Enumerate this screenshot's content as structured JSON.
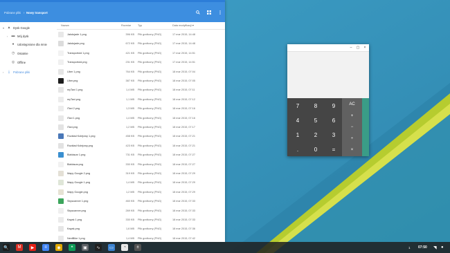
{
  "files": {
    "breadcrumb": {
      "root": "Pobrane pliki",
      "separator": "›",
      "current": "Nowy transport"
    },
    "header_icons": [
      "search-icon",
      "grid-view-icon",
      "more-vert-icon"
    ],
    "sidebar": {
      "items": [
        {
          "label": "Dysk Google",
          "icon": "drive-icon",
          "chevron": "▾"
        },
        {
          "label": "Mój dysk",
          "icon": "folder-icon",
          "chevron": "›"
        },
        {
          "label": "Udostępnione dla mnie",
          "icon": "people-icon",
          "chevron": ""
        },
        {
          "label": "Ostatnie",
          "icon": "clock-icon",
          "chevron": ""
        },
        {
          "label": "Offline",
          "icon": "offline-icon",
          "chevron": ""
        },
        {
          "label": "Pobrane pliki",
          "icon": "download-icon",
          "chevron": "›"
        }
      ]
    },
    "columns": {
      "name": "Nazwa",
      "size": "Rozmiar",
      "type": "Typ",
      "date": "Data modyfikacji ▾"
    },
    "rows": [
      {
        "name": "Jakdojade 1.png",
        "size": "396 KB",
        "type": "Plik graficzny (PNG)",
        "date": "17 mar 2015, 14:48",
        "thumb": "#e8e8e8"
      },
      {
        "name": "Jakdojade.png",
        "size": "672 KB",
        "type": "Plik graficzny (PNG)",
        "date": "17 mar 2015, 14:48",
        "thumb": "#dcdcdc"
      },
      {
        "name": "Transportoid 1.png",
        "size": "421 KB",
        "type": "Plik graficzny (PNG)",
        "date": "17 mar 2015, 14:51",
        "thumb": "#f2f2f2"
      },
      {
        "name": "Transportoid.png",
        "size": "231 KB",
        "type": "Plik graficzny (PNG)",
        "date": "17 mar 2015, 14:51",
        "thumb": "#f0f0f0"
      },
      {
        "name": "Uber 1.png",
        "size": "764 KB",
        "type": "Plik graficzny (PNG)",
        "date": "18 mar 2015, 07:04",
        "thumb": "#e5e5e5"
      },
      {
        "name": "Uber.png",
        "size": "387 KB",
        "type": "Plik graficzny (PNG)",
        "date": "18 mar 2015, 07:05",
        "thumb": "#1d1d1d"
      },
      {
        "name": "myTaxi 1.png",
        "size": "1,4 MB",
        "type": "Plik graficzny (PNG)",
        "date": "18 mar 2015, 07:11",
        "thumb": "#e6e6e6"
      },
      {
        "name": "myTaxi.png",
        "size": "1,1 MB",
        "type": "Plik graficzny (PNG)",
        "date": "18 mar 2015, 07:12",
        "thumb": "#ececec"
      },
      {
        "name": "iTaxi 2.png",
        "size": "1,3 MB",
        "type": "Plik graficzny (PNG)",
        "date": "18 mar 2015, 07:16",
        "thumb": "#ededed"
      },
      {
        "name": "iTaxi 1.png",
        "size": "1,4 MB",
        "type": "Plik graficzny (PNG)",
        "date": "18 mar 2015, 07:16",
        "thumb": "#e8e8e8"
      },
      {
        "name": "iTaxi.png",
        "size": "1,2 MB",
        "type": "Plik graficzny (PNG)",
        "date": "18 mar 2015, 07:17",
        "thumb": "#e3e3e3"
      },
      {
        "name": "Rozkład Kolejowy 1.png",
        "size": "458 KB",
        "type": "Plik graficzny (PNG)",
        "date": "18 mar 2015, 07:21",
        "thumb": "#4a78b8"
      },
      {
        "name": "Rozkład Kolejowy.png",
        "size": "423 KB",
        "type": "Plik graficzny (PNG)",
        "date": "18 mar 2015, 07:21",
        "thumb": "#e2e2e2"
      },
      {
        "name": "Blablacar 1.png",
        "size": "731 KB",
        "type": "Plik graficzny (PNG)",
        "date": "18 mar 2015, 07:27",
        "thumb": "#3a8fd0"
      },
      {
        "name": "Blablacar.png",
        "size": "330 KB",
        "type": "Plik graficzny (PNG)",
        "date": "18 mar 2015, 07:27",
        "thumb": "#f1f1f1"
      },
      {
        "name": "Mapy Google 2.png",
        "size": "319 KB",
        "type": "Plik graficzny (PNG)",
        "date": "18 mar 2015, 07:29",
        "thumb": "#e4e0d6"
      },
      {
        "name": "Mapy Google 1.png",
        "size": "1,4 MB",
        "type": "Plik graficzny (PNG)",
        "date": "18 mar 2015, 07:29",
        "thumb": "#dfe6d8"
      },
      {
        "name": "Mapy Google.png",
        "size": "1,2 MB",
        "type": "Plik graficzny (PNG)",
        "date": "18 mar 2015, 07:29",
        "thumb": "#e6e2d4"
      },
      {
        "name": "Skyscanner 1.png",
        "size": "460 KB",
        "type": "Plik graficzny (PNG)",
        "date": "18 mar 2015, 07:33",
        "thumb": "#3ca55c"
      },
      {
        "name": "Skyscanner.png",
        "size": "269 KB",
        "type": "Plik graficzny (PNG)",
        "date": "18 mar 2015, 07:33",
        "thumb": "#efefef"
      },
      {
        "name": "Kayak 1.png",
        "size": "330 KB",
        "type": "Plik graficzny (PNG)",
        "date": "18 mar 2015, 07:33",
        "thumb": "#ebebeb"
      },
      {
        "name": "Kayak.png",
        "size": "1,6 MB",
        "type": "Plik graficzny (PNG)",
        "date": "18 mar 2015, 07:36",
        "thumb": "#e6e6e6"
      },
      {
        "name": "NextBike 1.png",
        "size": "1,4 MB",
        "type": "Plik graficzny (PNG)",
        "date": "18 mar 2015, 07:42",
        "thumb": "#e9e9e9"
      }
    ]
  },
  "calculator": {
    "window_buttons": {
      "minimize": "–",
      "maximize": "▢",
      "close": "×"
    },
    "digits": [
      "7",
      "8",
      "9",
      "4",
      "5",
      "6",
      "1",
      "2",
      "3",
      ".",
      "0",
      "="
    ],
    "operators": [
      "AC",
      "+",
      "−",
      "÷",
      "×"
    ]
  },
  "shelf": {
    "apps": [
      {
        "name": "search-launcher-icon",
        "glyph": "🔍",
        "color": "#1d1d1d"
      },
      {
        "name": "gmail-app-icon",
        "glyph": "M",
        "color": "#d93025"
      },
      {
        "name": "youtube-app-icon",
        "glyph": "▶",
        "color": "#e62117"
      },
      {
        "name": "docs-app-icon",
        "glyph": "≡",
        "color": "#4285f4"
      },
      {
        "name": "chrome-app-icon",
        "glyph": "◉",
        "color": "#e0a800"
      },
      {
        "name": "hangouts-app-icon",
        "glyph": "❝",
        "color": "#0f9d58"
      },
      {
        "name": "window-app-icon",
        "glyph": "▣",
        "color": "#5f6368"
      },
      {
        "name": "chart-app-icon",
        "glyph": "∿",
        "color": "#202020"
      },
      {
        "name": "files-app-icon",
        "glyph": "▭",
        "color": "#3b82d0"
      },
      {
        "name": "store-app-icon",
        "glyph": "◔",
        "color": "#e8e8e8"
      },
      {
        "name": "calculator-app-icon",
        "glyph": "±",
        "color": "#525252"
      }
    ],
    "tray": {
      "notification": "1",
      "time": "07:50"
    }
  }
}
